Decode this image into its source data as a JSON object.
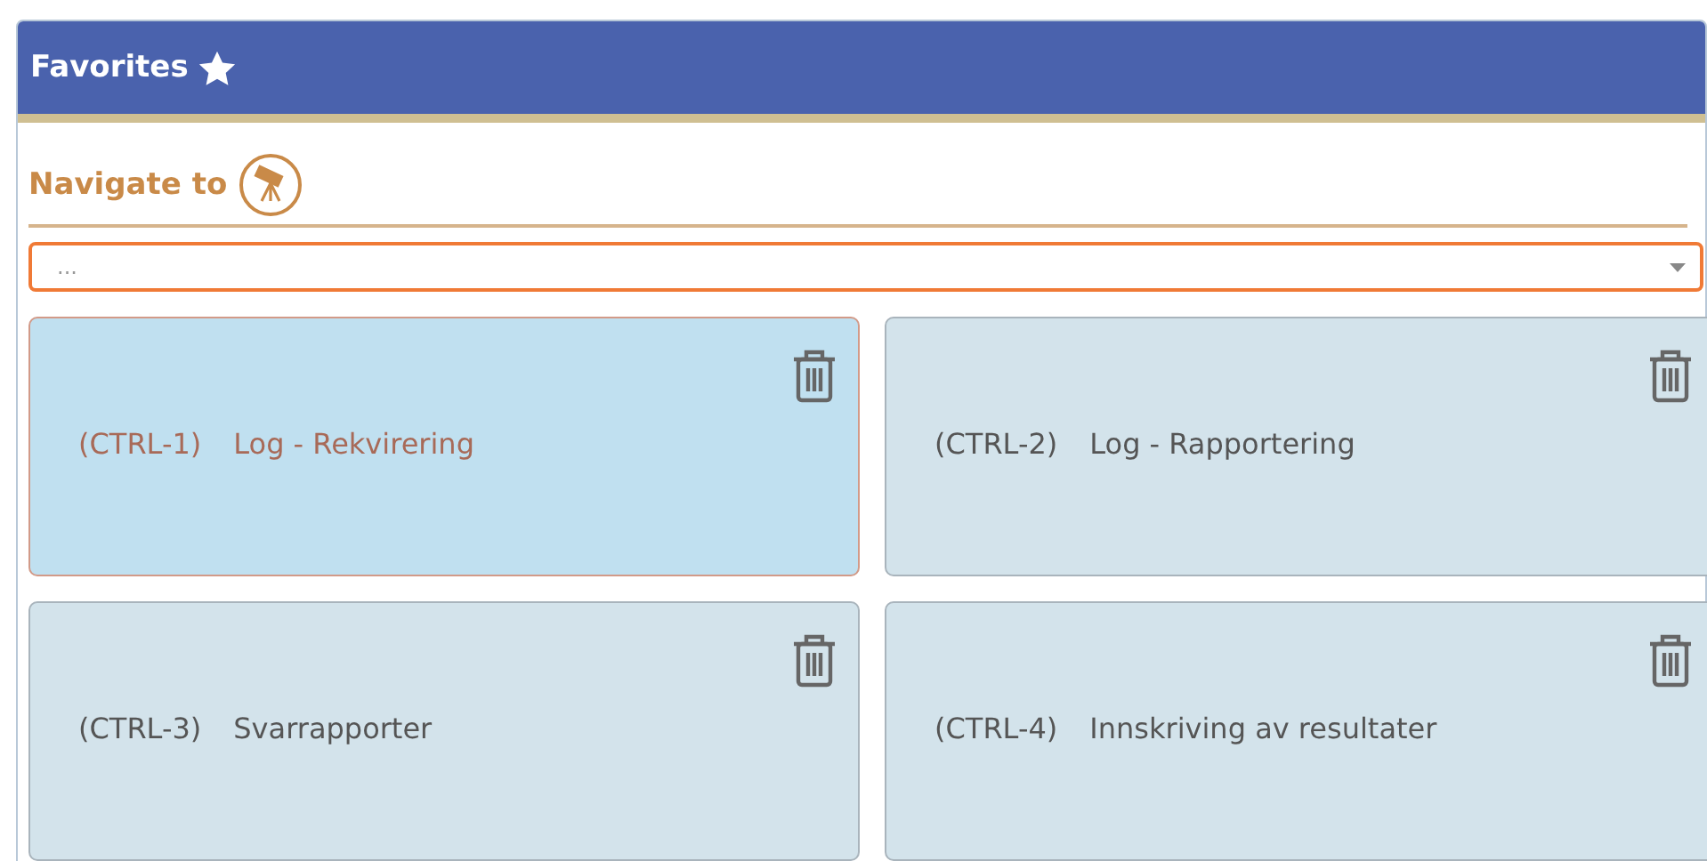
{
  "panel": {
    "title": "Favorites"
  },
  "navigate": {
    "label": "Navigate to",
    "placeholder": "..."
  },
  "favorites": [
    {
      "shortcut": "(CTRL-1)",
      "label": "Log - Rekvirering",
      "selected": true
    },
    {
      "shortcut": "(CTRL-2)",
      "label": "Log - Rapportering",
      "selected": false
    },
    {
      "shortcut": "(CTRL-3)",
      "label": "Svarrapporter",
      "selected": false
    },
    {
      "shortcut": "(CTRL-4)",
      "label": "Innskriving av resultater",
      "selected": false
    }
  ]
}
